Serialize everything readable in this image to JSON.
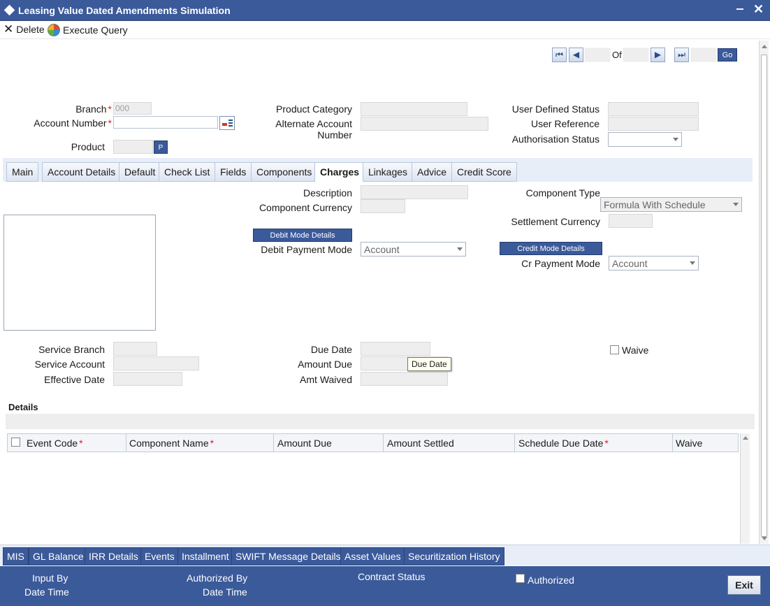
{
  "window": {
    "title": "Leasing Value Dated Amendments Simulation"
  },
  "toolbar": {
    "delete_label": "Delete",
    "execute_query_label": "Execute Query"
  },
  "nav": {
    "of_label": "Of",
    "go_label": "Go"
  },
  "header": {
    "branch_label": "Branch",
    "branch_value": "000",
    "account_number_label": "Account Number",
    "product_label": "Product",
    "product_button": "P",
    "product_category_label": "Product Category",
    "alternate_account_label_line1": "Alternate Account",
    "alternate_account_label_line2": "Number",
    "user_defined_status_label": "User Defined Status",
    "user_reference_label": "User Reference",
    "authorisation_status_label": "Authorisation Status"
  },
  "tabs": [
    {
      "label": "Main"
    },
    {
      "label": "Account Details"
    },
    {
      "label": "Default"
    },
    {
      "label": "Check List"
    },
    {
      "label": "Fields"
    },
    {
      "label": "Components"
    },
    {
      "label": "Charges",
      "active": true
    },
    {
      "label": "Linkages"
    },
    {
      "label": "Advice"
    },
    {
      "label": "Credit Score"
    }
  ],
  "charges": {
    "description_label": "Description",
    "component_currency_label": "Component Currency",
    "debit_mode_button": "Debit Mode Details",
    "debit_payment_mode_label": "Debit Payment Mode",
    "debit_payment_mode_value": "Account",
    "component_type_label": "Component Type",
    "component_type_value": "Formula With Schedule",
    "settlement_currency_label": "Settlement Currency",
    "credit_mode_button": "Credit Mode Details",
    "cr_payment_mode_label": "Cr Payment Mode",
    "cr_payment_mode_value": "Account",
    "service_branch_label": "Service Branch",
    "service_account_label": "Service Account",
    "effective_date_label": "Effective Date",
    "due_date_label": "Due Date",
    "amount_due_label": "Amount Due",
    "amt_waived_label": "Amt Waived",
    "waive_label": "Waive",
    "tooltip_text": "Due Date"
  },
  "details": {
    "title": "Details",
    "columns": [
      {
        "label": "Event Code",
        "required": true
      },
      {
        "label": "Component Name",
        "required": true
      },
      {
        "label": "Amount Due",
        "required": false
      },
      {
        "label": "Amount Settled",
        "required": false
      },
      {
        "label": "Schedule Due Date",
        "required": true
      },
      {
        "label": "Waive",
        "required": false
      }
    ]
  },
  "bottom_tabs": [
    "MIS",
    "GL Balance",
    "IRR Details",
    "Events",
    "Installment",
    "SWIFT Message Details",
    "Asset Values",
    "Securitization History"
  ],
  "footer": {
    "input_by_label": "Input By",
    "date_time_label_1": "Date Time",
    "authorized_by_label": "Authorized By",
    "date_time_label_2": "Date Time",
    "contract_status_label": "Contract Status",
    "authorized_label": "Authorized",
    "exit_label": "Exit"
  },
  "colors": {
    "header_blue": "#3b5a9a",
    "required_red": "#e31b1b"
  }
}
